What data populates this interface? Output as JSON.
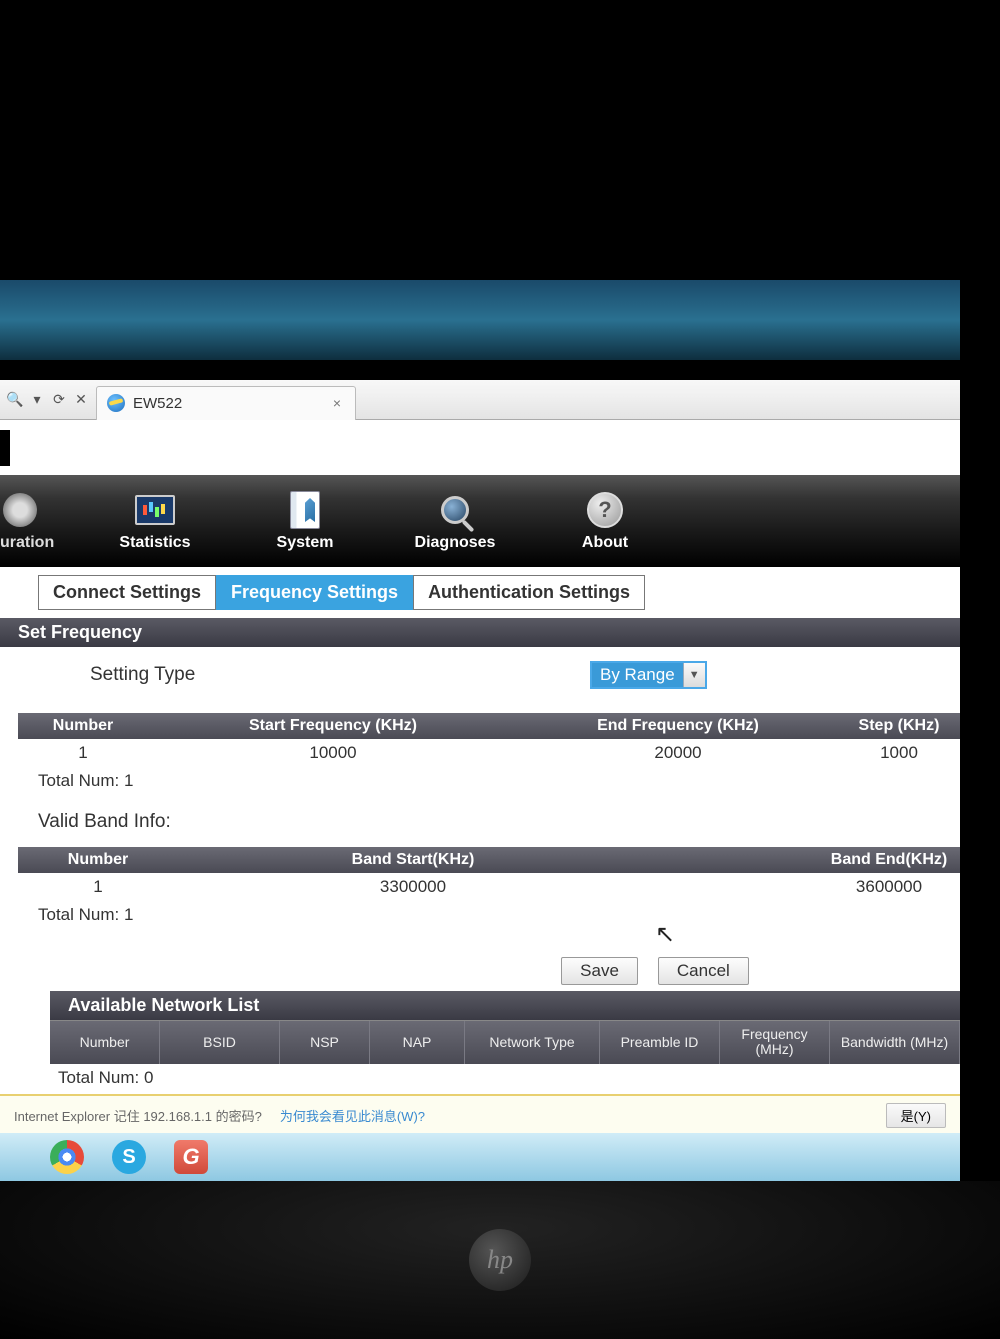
{
  "browser": {
    "tab_title": "EW522",
    "search_glyph": "🔍",
    "dropdown_glyph": "▾",
    "refresh_glyph": "⟳",
    "stop_glyph": "✕",
    "tab_close": "×"
  },
  "nav": {
    "partial_label": "uration",
    "items": [
      {
        "label": "Statistics"
      },
      {
        "label": "System"
      },
      {
        "label": "Diagnoses"
      },
      {
        "label": "About"
      }
    ],
    "about_glyph": "?"
  },
  "sub_tabs": {
    "connect": "Connect Settings",
    "frequency": "Frequency Settings",
    "auth": "Authentication Settings"
  },
  "set_freq": {
    "title": "Set Frequency",
    "setting_type_label": "Setting Type",
    "setting_type_value": "By Range",
    "cols": {
      "number": "Number",
      "start": "Start Frequency (KHz)",
      "end": "End Frequency (KHz)",
      "step": "Step (KHz)"
    },
    "row": {
      "number": "1",
      "start": "10000",
      "end": "20000",
      "step": "1000"
    },
    "total": "Total Num: 1"
  },
  "valid_band": {
    "label": "Valid Band Info:",
    "cols": {
      "number": "Number",
      "start": "Band Start(KHz)",
      "end": "Band End(KHz)"
    },
    "row": {
      "number": "1",
      "start": "3300000",
      "end": "3600000"
    },
    "total": "Total Num: 1"
  },
  "buttons": {
    "save": "Save",
    "cancel": "Cancel"
  },
  "avail_net": {
    "title": "Available Network List",
    "cols": {
      "number": "Number",
      "bsid": "BSID",
      "nsp": "NSP",
      "nap": "NAP",
      "ntype": "Network Type",
      "preamble": "Preamble ID",
      "freq": "Frequency (MHz)",
      "bw": "Bandwidth (MHz)"
    },
    "total": "Total Num: 0"
  },
  "ie_bar": {
    "prompt": "Internet Explorer 记住 192.168.1.1 的密码?",
    "link": "为何我会看见此消息(W)?",
    "yes": "是(Y)"
  },
  "hp_logo": "hp"
}
